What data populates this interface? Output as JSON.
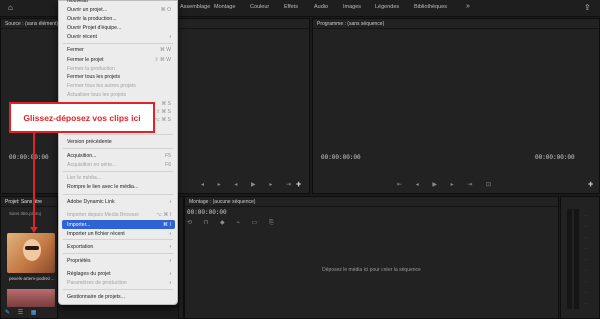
{
  "topbar": {
    "home_icon": "home-icon",
    "workspaces": [
      "Assemblage",
      "Montage",
      "Couleur",
      "Effets",
      "Audio",
      "Images",
      "Légendes",
      "Bibliothèques"
    ],
    "more": "»",
    "share_icon": "share-icon"
  },
  "source": {
    "title": "Source : (sans élément)",
    "timecode": "00:00:00:00"
  },
  "program": {
    "title": "Programme : (sans séquence)",
    "timecode_left": "00:00:00:00",
    "timecode_right": "00:00:00:00"
  },
  "project": {
    "tab": "Projet: Sans titre",
    "subtitle": "Sans titre.prproj",
    "clip_label": "pexels-artem-podrez…"
  },
  "timeline": {
    "title": "Montage : (aucune séquence)",
    "timecode": "00:00:00:00",
    "empty_text": "Déposez le média ici pour créer la séquence"
  },
  "callout": {
    "text": "Glissez-déposez vos clips ici"
  },
  "menu": {
    "items": [
      {
        "label": "Nouveau",
        "disabled": false,
        "shortcut": "",
        "arrow": false
      },
      {
        "label": "Ouvrir un projet...",
        "disabled": false,
        "shortcut": "⌘ O",
        "arrow": false
      },
      {
        "label": "Ouvrir la production...",
        "disabled": false,
        "shortcut": "",
        "arrow": false
      },
      {
        "label": "Ouvrir Projet d'équipe...",
        "disabled": false,
        "shortcut": "",
        "arrow": false
      },
      {
        "label": "Ouvrir récent",
        "disabled": false,
        "shortcut": "",
        "arrow": true
      },
      {
        "label": "Fermer",
        "disabled": false,
        "shortcut": "⌘ W",
        "arrow": false
      },
      {
        "label": "Fermer le projet",
        "disabled": false,
        "shortcut": "⇧ ⌘ W",
        "arrow": false
      },
      {
        "label": "Fermer la production",
        "disabled": true,
        "shortcut": "",
        "arrow": false
      },
      {
        "label": "Fermer tous les projets",
        "disabled": false,
        "shortcut": "",
        "arrow": false
      },
      {
        "label": "Fermer tous les autres projets",
        "disabled": true,
        "shortcut": "",
        "arrow": false
      },
      {
        "label": "Actualiser tous les projets",
        "disabled": true,
        "shortcut": "",
        "arrow": false
      },
      {
        "label": "",
        "disabled": false,
        "shortcut": "⌘ S",
        "arrow": false
      },
      {
        "label": "",
        "disabled": false,
        "shortcut": "⇧ ⌘ S",
        "arrow": false
      },
      {
        "label": "",
        "disabled": false,
        "shortcut": "⌥ ⌘ S",
        "arrow": false
      },
      {
        "label": "Version précédente",
        "disabled": false,
        "shortcut": "",
        "arrow": false
      },
      {
        "label": "Acquisition...",
        "disabled": false,
        "shortcut": "F5",
        "arrow": false
      },
      {
        "label": "Acquisition en série...",
        "disabled": true,
        "shortcut": "F6",
        "arrow": false
      },
      {
        "label": "Lier le média...",
        "disabled": true,
        "shortcut": "",
        "arrow": false
      },
      {
        "label": "Rompre le lien avec le média...",
        "disabled": false,
        "shortcut": "",
        "arrow": false
      },
      {
        "label": "Adobe Dynamic Link",
        "disabled": false,
        "shortcut": "",
        "arrow": true
      },
      {
        "label": "Importer depuis Media Browser",
        "disabled": true,
        "shortcut": "⌥ ⌘ I",
        "arrow": false
      },
      {
        "label": "Importer...",
        "disabled": false,
        "shortcut": "⌘ I",
        "arrow": false,
        "highlighted": true
      },
      {
        "label": "Importer un fichier récent",
        "disabled": false,
        "shortcut": "",
        "arrow": true
      },
      {
        "label": "Exportation",
        "disabled": false,
        "shortcut": "",
        "arrow": true
      },
      {
        "label": "Propriétés",
        "disabled": false,
        "shortcut": "",
        "arrow": true
      },
      {
        "label": "Réglages du projet",
        "disabled": false,
        "shortcut": "",
        "arrow": true
      },
      {
        "label": "Paramètres de production",
        "disabled": true,
        "shortcut": "",
        "arrow": true
      },
      {
        "label": "Gestionnaire de projets...",
        "disabled": false,
        "shortcut": "",
        "arrow": false
      }
    ]
  },
  "colors": {
    "highlight": "#2e63d6",
    "callout_red": "#e0232a"
  }
}
